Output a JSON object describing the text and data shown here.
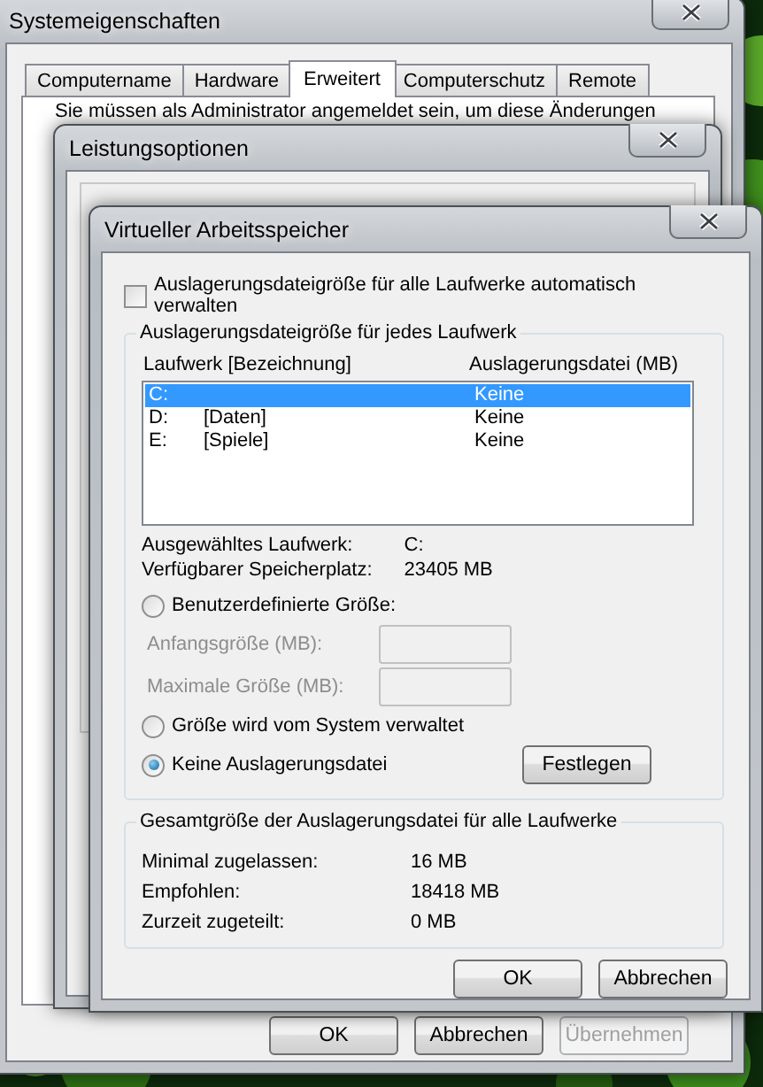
{
  "system_properties": {
    "title": "Systemeigenschaften",
    "tabs": [
      {
        "label": "Computername",
        "selected": false
      },
      {
        "label": "Hardware",
        "selected": false
      },
      {
        "label": "Erweitert",
        "selected": true
      },
      {
        "label": "Computerschutz",
        "selected": false
      },
      {
        "label": "Remote",
        "selected": false
      }
    ],
    "notice": "Sie müssen als Administrator angemeldet sein, um diese Änderungen",
    "buttons": [
      {
        "label": "OK",
        "disabled": false
      },
      {
        "label": "Abbrechen",
        "disabled": false
      },
      {
        "label": "Übernehmen",
        "disabled": true
      }
    ]
  },
  "performance_options": {
    "title": "Leistungsoptionen"
  },
  "virtual_memory": {
    "title": "Virtueller Arbeitsspeicher",
    "auto_manage": {
      "label": "Auslagerungsdateigröße für alle Laufwerke automatisch verwalten",
      "checked": false
    },
    "drives_group": {
      "legend": "Auslagerungsdateigröße für jedes Laufwerk",
      "columns": [
        "Laufwerk [Bezeichnung]",
        "Auslagerungsdatei (MB)"
      ],
      "drives": [
        {
          "drive": "C:",
          "paging_file": "Keine",
          "selected": true
        },
        {
          "drive": "D:",
          "label": "[Daten]",
          "paging_file": "Keine",
          "selected": false
        },
        {
          "drive": "E:",
          "label": "[Spiele]",
          "paging_file": "Keine",
          "selected": false
        }
      ],
      "info": [
        {
          "label": "Ausgewähltes Laufwerk:",
          "value": "C:"
        },
        {
          "label": "Verfügbarer Speicherplatz:",
          "value": "23405 MB"
        }
      ],
      "options": [
        {
          "kind": "radio",
          "label": "Benutzerdefinierte Größe:",
          "selected": false
        },
        {
          "kind": "field",
          "label": "Anfangsgröße (MB):",
          "disabled": true
        },
        {
          "kind": "field",
          "label": "Maximale Größe (MB):",
          "disabled": true
        },
        {
          "kind": "radio",
          "label": "Größe wird vom System verwaltet",
          "selected": false
        },
        {
          "kind": "radio",
          "label": "Keine Auslagerungsdatei",
          "selected": true
        }
      ],
      "set_button": "Festlegen"
    },
    "total_group": {
      "legend": "Gesamtgröße der Auslagerungsdatei für alle Laufwerke",
      "rows": [
        {
          "label": "Minimal zugelassen:",
          "value": "16 MB"
        },
        {
          "label": "Empfohlen:",
          "value": "18418 MB"
        },
        {
          "label": "Zurzeit zugeteilt:",
          "value": "0 MB"
        }
      ]
    },
    "buttons": [
      {
        "label": "OK",
        "disabled": false
      },
      {
        "label": "Abbrechen",
        "disabled": false
      }
    ]
  }
}
